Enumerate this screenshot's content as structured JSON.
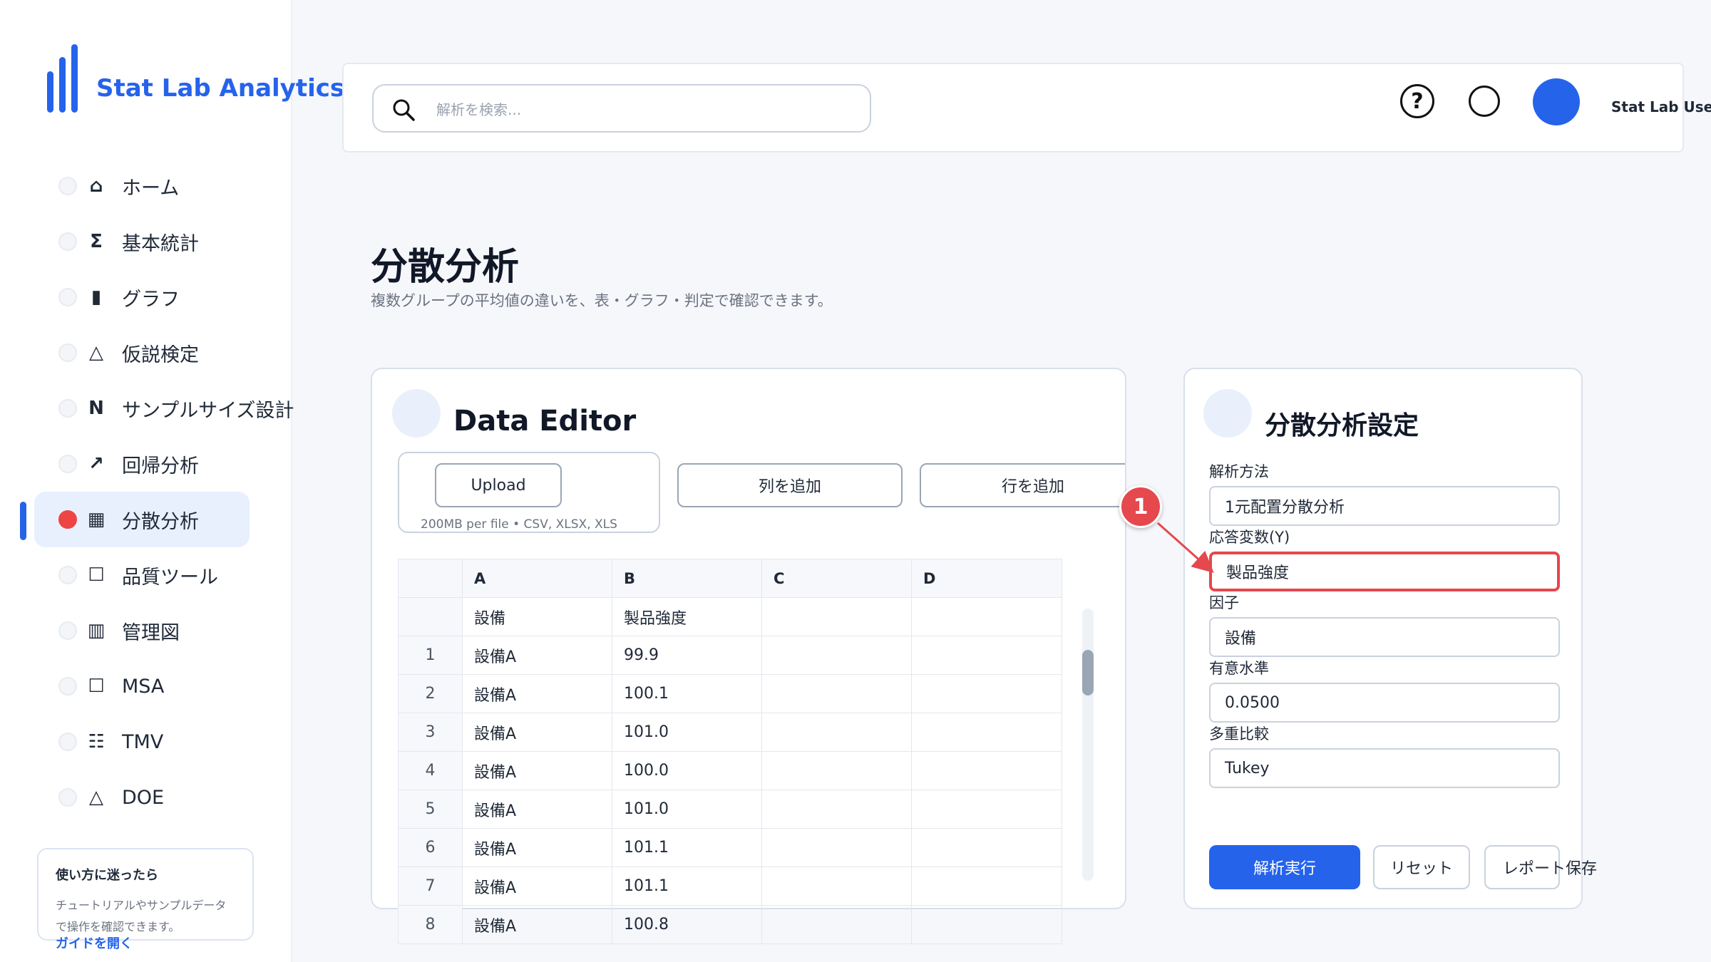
{
  "brand": {
    "name": "Stat Lab Analytics",
    "color": "#2563eb"
  },
  "sidebar": {
    "items": [
      {
        "glyph": "⌂",
        "icon": "home-icon",
        "label": "ホーム"
      },
      {
        "glyph": "Σ",
        "icon": "sigma-icon",
        "label": "基本統計"
      },
      {
        "glyph": "▮",
        "icon": "bar-chart-icon",
        "label": "グラフ"
      },
      {
        "glyph": "△",
        "icon": "triangle-icon",
        "label": "仮説検定"
      },
      {
        "glyph": "N",
        "icon": "n-icon",
        "label": "サンプルサイズ設計"
      },
      {
        "glyph": "↗",
        "icon": "trend-arrow-icon",
        "label": "回帰分析"
      },
      {
        "glyph": "▦",
        "icon": "grid-icon",
        "label": "分散分析",
        "active": true
      },
      {
        "glyph": "☐",
        "icon": "square-icon",
        "label": "品質ツール"
      },
      {
        "glyph": "▥",
        "icon": "control-chart-icon",
        "label": "管理図"
      },
      {
        "glyph": "☐",
        "icon": "square-icon",
        "label": "MSA"
      },
      {
        "glyph": "☷",
        "icon": "list-icon",
        "label": "TMV"
      },
      {
        "glyph": "△",
        "icon": "triangle-icon",
        "label": "DOE"
      }
    ],
    "help": {
      "title": "使い方に迷ったら",
      "description": "チュートリアルやサンプルデータで操作を確認できます。",
      "link": "ガイドを開く"
    }
  },
  "header": {
    "search_placeholder": "解析を検索...",
    "help_glyph": "?",
    "user_name": "Stat Lab User"
  },
  "page": {
    "title": "分散分析",
    "subtitle": "複数グループの平均値の違いを、表・グラフ・判定で確認できます。"
  },
  "editor": {
    "title": "Data Editor",
    "upload_label": "Upload",
    "upload_note": "200MB per file • CSV, XLSX, XLS",
    "add_column": "列を追加",
    "add_row": "行を追加",
    "columns": [
      "A",
      "B",
      "C",
      "D"
    ],
    "header_row": [
      "設備",
      "製品強度",
      "",
      ""
    ],
    "rows": [
      {
        "n": "1",
        "a": "設備A",
        "b": "99.9"
      },
      {
        "n": "2",
        "a": "設備A",
        "b": "100.1"
      },
      {
        "n": "3",
        "a": "設備A",
        "b": "101.0"
      },
      {
        "n": "4",
        "a": "設備A",
        "b": "100.0"
      },
      {
        "n": "5",
        "a": "設備A",
        "b": "101.0"
      },
      {
        "n": "6",
        "a": "設備A",
        "b": "101.1"
      },
      {
        "n": "7",
        "a": "設備A",
        "b": "101.1"
      },
      {
        "n": "8",
        "a": "設備A",
        "b": "100.8"
      }
    ]
  },
  "settings": {
    "title": "分散分析設定",
    "fields": [
      {
        "label": "解析方法",
        "value": "1元配置分散分析"
      },
      {
        "label": "応答変数(Y)",
        "value": "製品強度",
        "highlight": true
      },
      {
        "label": "因子",
        "value": "設備"
      },
      {
        "label": "有意水準",
        "value": "0.0500"
      },
      {
        "label": "多重比較",
        "value": "Tukey"
      }
    ],
    "run": "解析実行",
    "reset": "リセット",
    "save_report": "レポート保存"
  },
  "annotation": {
    "number": "1",
    "color": "#e5484d"
  }
}
